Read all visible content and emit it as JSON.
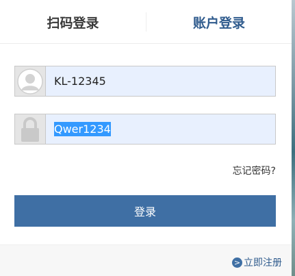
{
  "tabs": {
    "qr_login": "扫码登录",
    "account_login": "账户登录"
  },
  "form": {
    "username_value": "KL-12345",
    "password_value": "Qwer1234",
    "forgot_password": "忘记密码?",
    "login_button": "登录"
  },
  "footer": {
    "register_link": "立即注册",
    "register_icon_glyph": ">"
  },
  "icons": {
    "username": "user-avatar-icon",
    "password": "lock-icon",
    "register": "arrow-right-circle-icon"
  },
  "colors": {
    "accent": "#3f6fa4",
    "active_tab": "#2f5b8d",
    "autofill_bg": "#e8f0fe",
    "selection": "#3399ff"
  }
}
